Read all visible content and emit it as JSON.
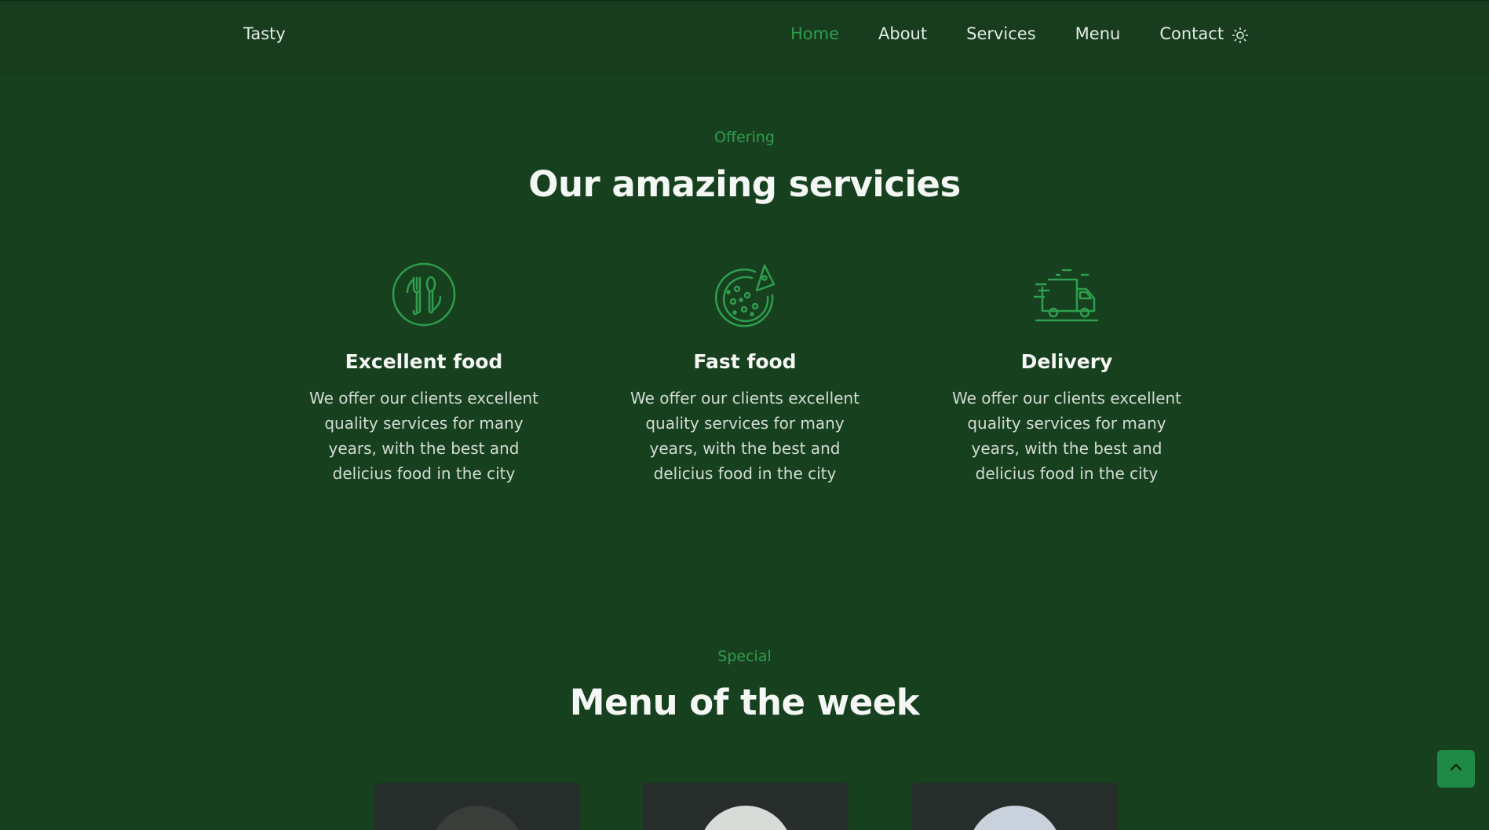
{
  "header": {
    "logo": "Tasty",
    "nav": [
      "Home",
      "About",
      "Services",
      "Menu",
      "Contact"
    ],
    "active_nav": "Home",
    "theme_icon": "sun-icon"
  },
  "services_section": {
    "subtitle": "Offering",
    "title": "Our amazing servicies",
    "items": [
      {
        "icon": "fork-spoon-plate-icon",
        "title": "Excellent food",
        "description": "We offer our clients excellent quality services for many years, with the best and delicius food in the city"
      },
      {
        "icon": "pizza-icon",
        "title": "Fast food",
        "description": "We offer our clients excellent quality services for many years, with the best and delicius food in the city"
      },
      {
        "icon": "delivery-truck-icon",
        "title": "Delivery",
        "description": "We offer our clients excellent quality services for many years, with the best and delicius food in the city"
      }
    ]
  },
  "menu_section": {
    "subtitle": "Special",
    "title": "Menu of the week"
  },
  "scroll_top_icon": "chevron-up-icon",
  "colors": {
    "background": "#17401f",
    "accent": "#2f9e4e",
    "card": "#262d2a"
  }
}
